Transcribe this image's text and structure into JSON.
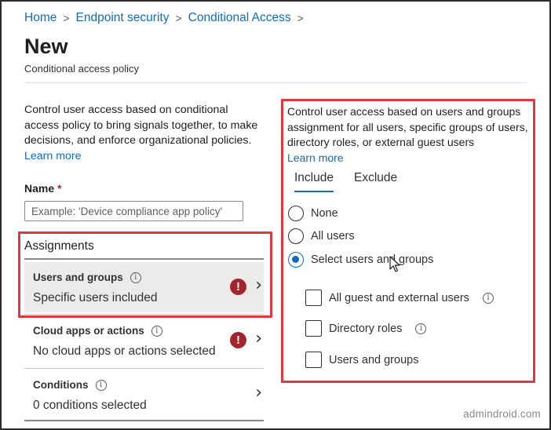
{
  "breadcrumb": {
    "items": [
      "Home",
      "Endpoint security",
      "Conditional Access"
    ],
    "separator": ">"
  },
  "header": {
    "title": "New",
    "subtitle": "Conditional access policy"
  },
  "left": {
    "description": "Control user access based on conditional access policy to bring signals together, to make decisions, and enforce organizational policies.",
    "learn_more": "Learn more",
    "name_label": "Name",
    "required_mark": "*",
    "name_placeholder": "Example: 'Device compliance app policy'",
    "name_value": ""
  },
  "assignments": {
    "heading": "Assignments",
    "items": [
      {
        "title": "Users and groups",
        "value": "Specific users included",
        "has_error": true,
        "selected": true
      },
      {
        "title": "Cloud apps or actions",
        "value": "No cloud apps or actions selected",
        "has_error": true,
        "selected": false
      },
      {
        "title": "Conditions",
        "value": "0 conditions selected",
        "has_error": false,
        "selected": false
      }
    ]
  },
  "right": {
    "description": "Control user access based on users and groups assignment for all users, specific groups of users, directory roles, or external guest users",
    "learn_more": "Learn more",
    "tabs": [
      {
        "label": "Include",
        "active": true
      },
      {
        "label": "Exclude",
        "active": false
      }
    ],
    "radios": [
      {
        "label": "None",
        "checked": false
      },
      {
        "label": "All users",
        "checked": false
      },
      {
        "label": "Select users and groups",
        "checked": true
      }
    ],
    "checkboxes": [
      {
        "label": "All guest and external users",
        "checked": false,
        "info": true
      },
      {
        "label": "Directory roles",
        "checked": false,
        "info": true
      },
      {
        "label": "Users and groups",
        "checked": false,
        "info": false
      }
    ]
  },
  "icons": {
    "info": "info-icon",
    "error": "error-icon",
    "chevron": "chevron-right-icon",
    "cursor": "mouse-cursor-icon"
  },
  "colors": {
    "link": "#0f6cbd",
    "highlight_box": "#e0383e",
    "error": "#a4262c",
    "selected_row": "#ecebea"
  },
  "watermark": "admindroid.com"
}
